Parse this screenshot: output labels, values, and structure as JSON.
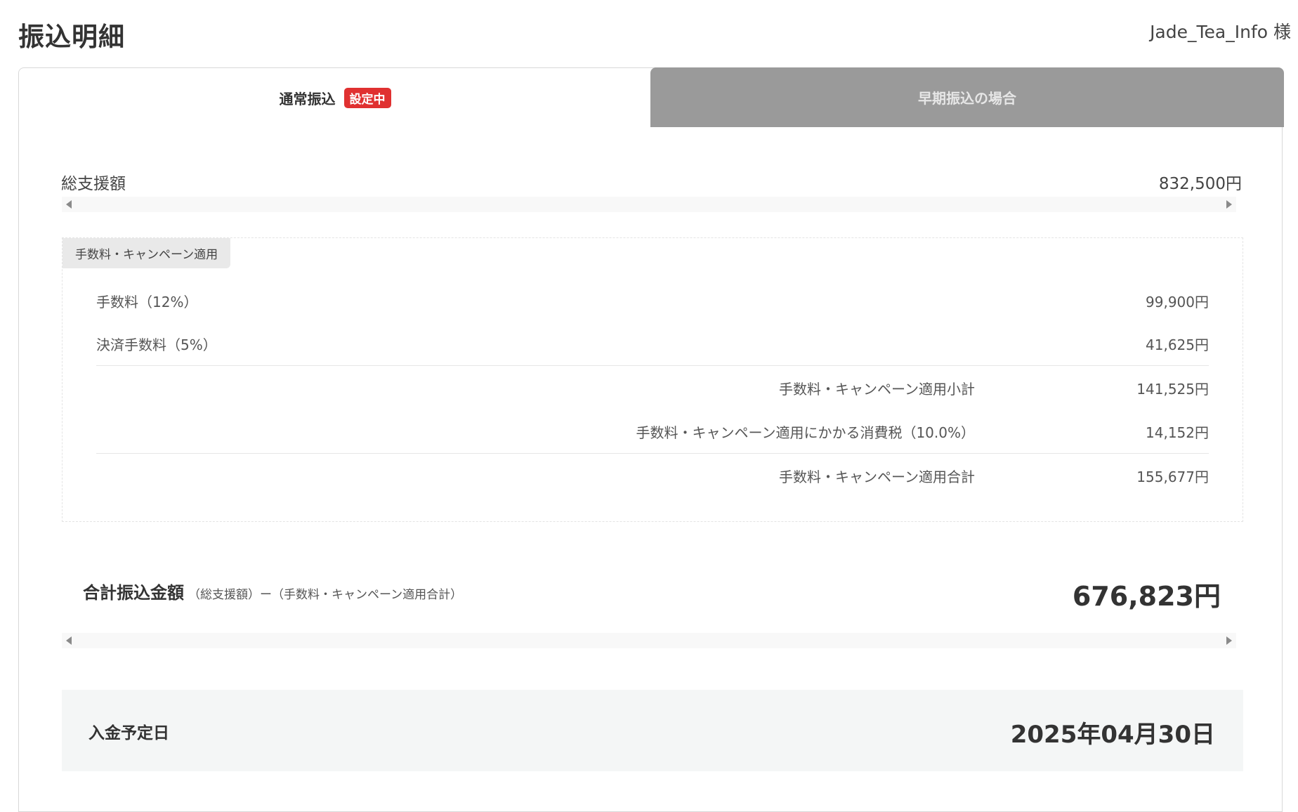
{
  "page": {
    "title": "振込明細",
    "user_name": "Jade_Tea_Info 様"
  },
  "tabs": {
    "normal": {
      "label": "通常振込",
      "badge": "設定中"
    },
    "early": {
      "label": "早期振込の場合"
    }
  },
  "summary": {
    "total_support_label": "総支援額",
    "total_support_value": "832,500円"
  },
  "fees": {
    "section_label": "手数料・キャンペーン適用",
    "items": [
      {
        "label": "手数料（12%）",
        "value": "99,900円"
      },
      {
        "label": "決済手数料（5%）",
        "value": "41,625円"
      }
    ],
    "subtotal_label": "手数料・キャンペーン適用小計",
    "subtotal_value": "141,525円",
    "tax_label": "手数料・キャンペーン適用にかかる消費税（10.0%）",
    "tax_value": "14,152円",
    "total_label": "手数料・キャンペーン適用合計",
    "total_value": "155,677円"
  },
  "grand_total": {
    "label": "合計振込金額",
    "note": "（総支援額）ー（手数料・キャンペーン適用合計）",
    "value": "676,823円"
  },
  "deposit": {
    "label": "入金予定日",
    "date": "2025年04月30日"
  },
  "colors": {
    "badge": "#e03131",
    "inactive_tab": "#9a9a9a",
    "date_box_bg": "#f4f6f6"
  }
}
